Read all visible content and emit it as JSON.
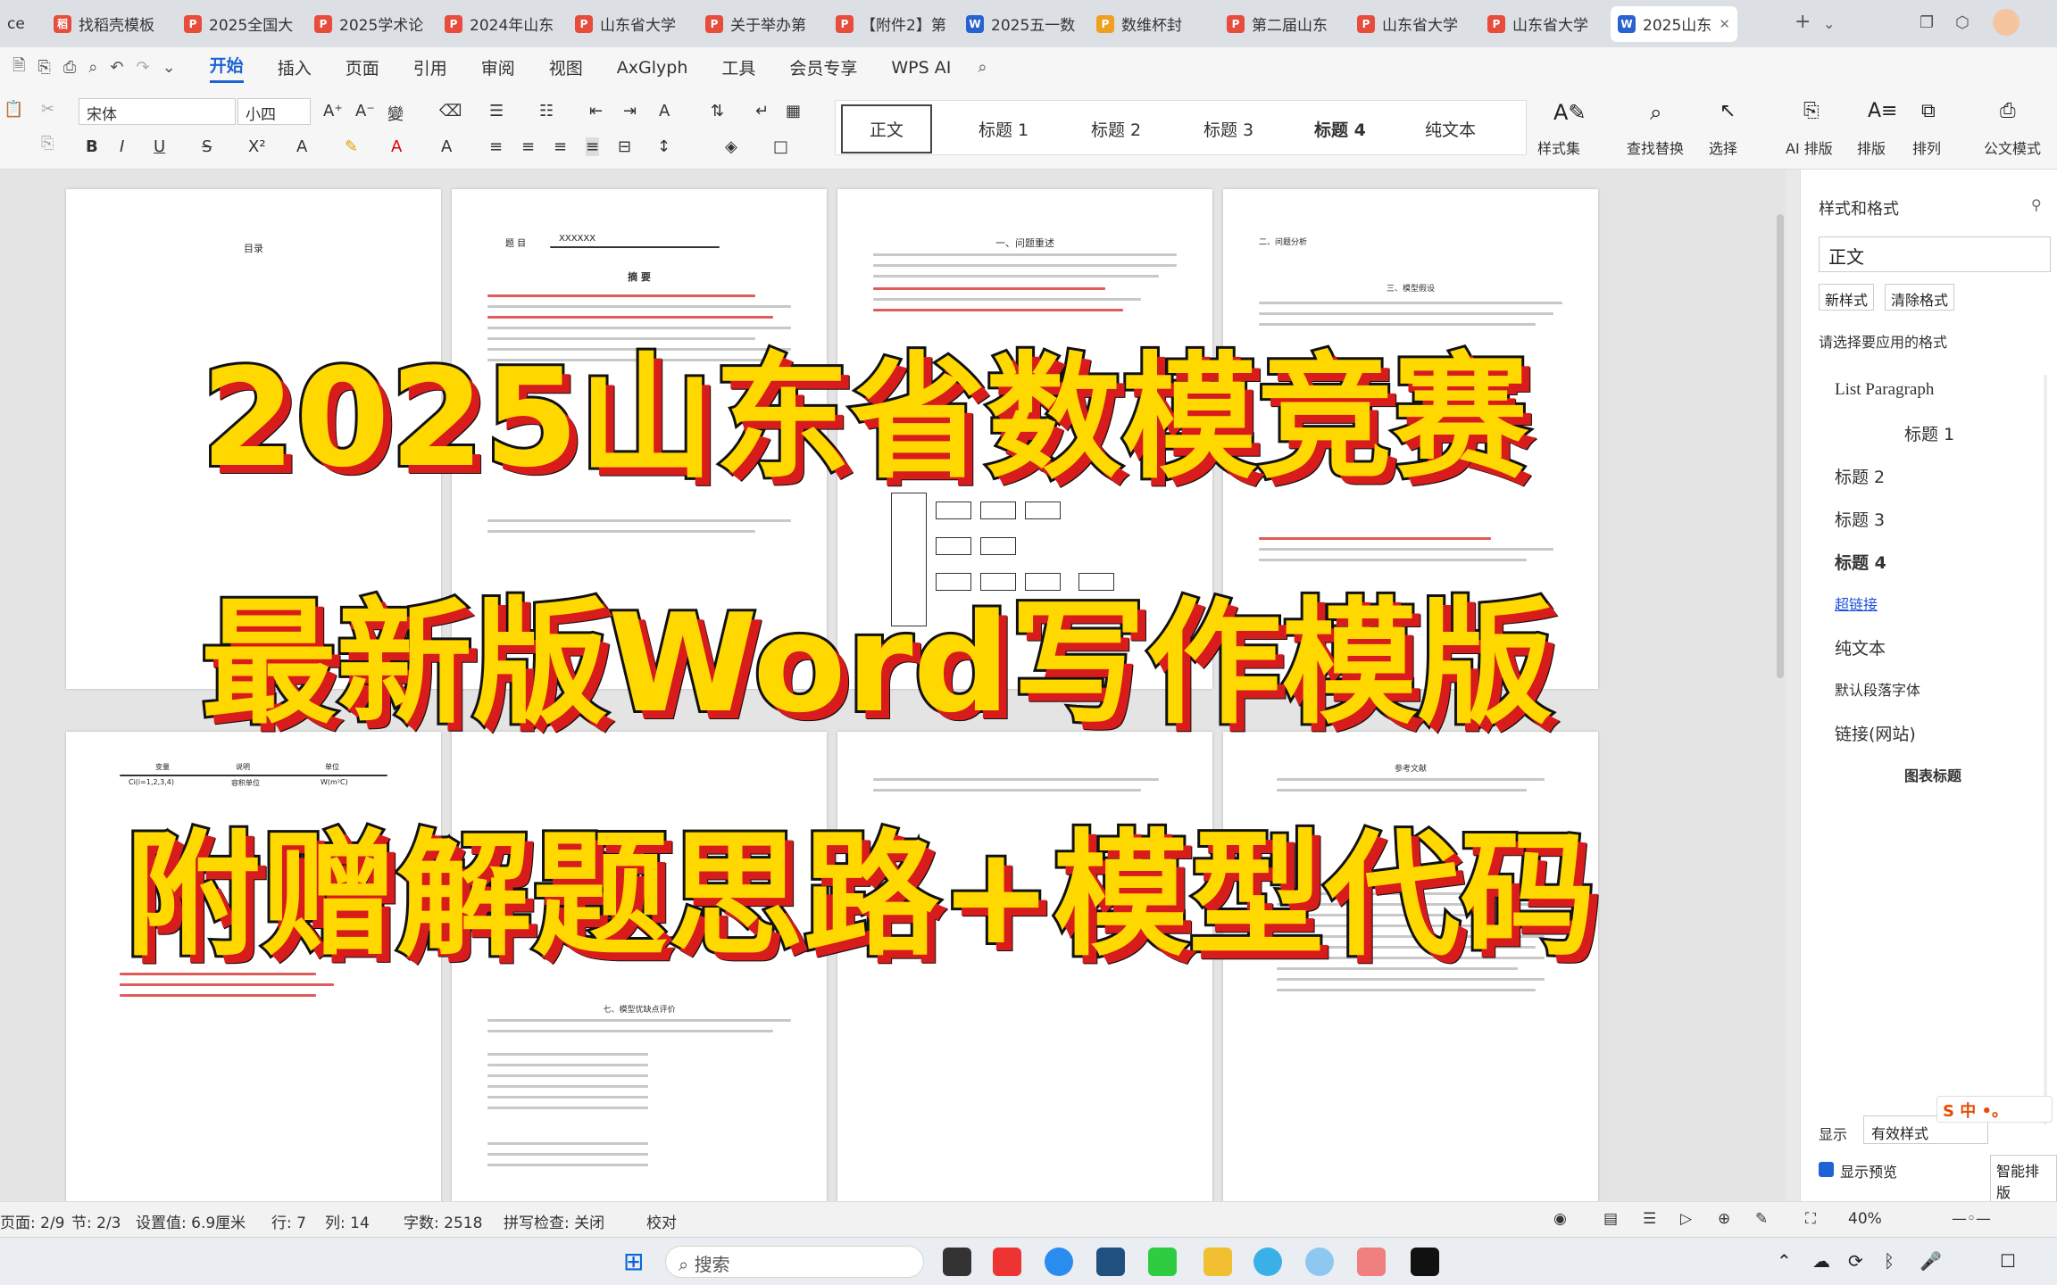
{
  "tabs": [
    {
      "label": "ce",
      "icon": "",
      "color": "#e84c3d"
    },
    {
      "label": "找稻壳模板",
      "icon": "稻",
      "color": "#e84c3d"
    },
    {
      "label": "2025全国大",
      "icon": "P",
      "color": "#e84c3d"
    },
    {
      "label": "2025学术论",
      "icon": "P",
      "color": "#e84c3d"
    },
    {
      "label": "2024年山东",
      "icon": "P",
      "color": "#e84c3d"
    },
    {
      "label": "山东省大学",
      "icon": "P",
      "color": "#e84c3d"
    },
    {
      "label": "关于举办第",
      "icon": "P",
      "color": "#e84c3d"
    },
    {
      "label": "【附件2】第",
      "icon": "P",
      "color": "#e84c3d"
    },
    {
      "label": "2025五一数",
      "icon": "W",
      "color": "#2b62d1"
    },
    {
      "label": "数维杯封",
      "icon": "P",
      "color": "#f0a020"
    },
    {
      "label": "第二届山东",
      "icon": "P",
      "color": "#e84c3d"
    },
    {
      "label": "山东省大学",
      "icon": "P",
      "color": "#e84c3d"
    },
    {
      "label": "山东省大学",
      "icon": "P",
      "color": "#e84c3d"
    },
    {
      "label": "2025山东",
      "icon": "W",
      "color": "#2b62d1",
      "active": true
    }
  ],
  "menu": [
    "开始",
    "插入",
    "页面",
    "引用",
    "审阅",
    "视图",
    "AxGlyph",
    "工具",
    "会员专享",
    "WPS AI"
  ],
  "ribbon": {
    "font_name": "宋体",
    "font_size": "小四",
    "styles": [
      "正文",
      "标题 1",
      "标题 2",
      "标题 3",
      "标题 4",
      "纯文本"
    ],
    "style_set": "样式集",
    "find_replace": "查找替换",
    "select": "选择",
    "ai_layout": "AI 排版",
    "layout": "排版",
    "arrange": "排列",
    "official_mode": "公文模式"
  },
  "banner": {
    "line1": "2025山东省数模竞赛",
    "line2": "最新版Word写作模版",
    "line3": "附赠解题思路+模型代码"
  },
  "pages": {
    "p1_head": "目录",
    "p2_title": "摘   要",
    "p2_field": "题    目",
    "p2_field_value": "XXXXXX",
    "p3_head": "一、问题重述",
    "p4_head": "二、问题分析",
    "p4_sub": "三、模型假设",
    "p7_head": "七、模型优缺点评价",
    "p8_head": "参考文献",
    "table_cols": [
      "变量",
      "说明",
      "单位"
    ],
    "table_row": [
      "Ci(i=1,2,3,4)",
      "容积单位",
      "W(m²C)"
    ]
  },
  "sidepane": {
    "title": "样式和格式",
    "current": "正文",
    "new_style": "新样式",
    "clear_format": "清除格式",
    "apply_label": "请选择要应用的格式",
    "items": [
      "List Paragraph",
      "标题 1",
      "标题 2",
      "标题 3",
      "标题 4",
      "超链接",
      "纯文本",
      "默认段落字体",
      "链接(网站)",
      "图表标题"
    ],
    "show_label": "显示",
    "show_value": "有效样式",
    "preview_label": "显示预览",
    "smart_layout": "智能排版"
  },
  "status": {
    "page": "页面: 2/9",
    "section": "节: 2/3",
    "setting": "设置值: 6.9厘米",
    "row": "行: 7",
    "col": "列: 14",
    "words": "字数: 2518",
    "spell": "拼写检查: 关闭",
    "proof": "校对",
    "zoom": "40%"
  },
  "taskbar": {
    "search": "搜索"
  }
}
